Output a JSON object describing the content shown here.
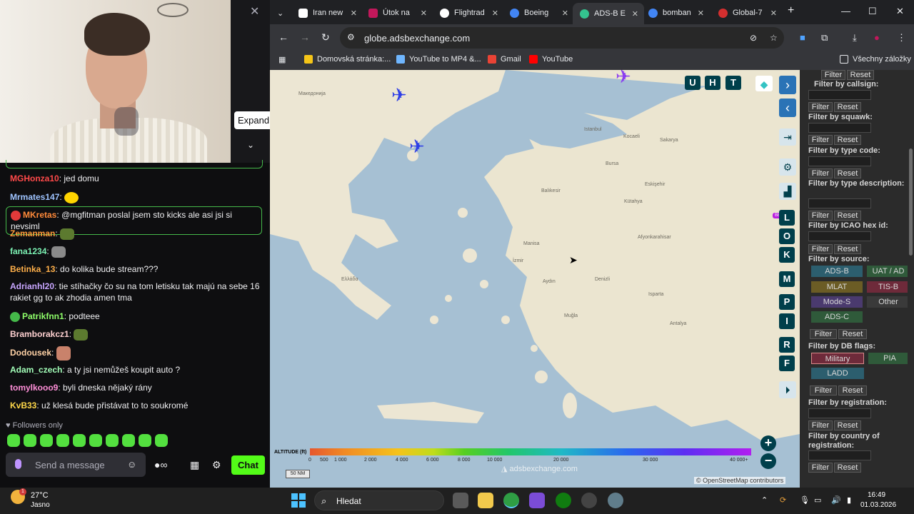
{
  "chat": {
    "expand_tooltip": "Expand",
    "messages": [
      {
        "user": "MGHonza10",
        "color": "#ff4a4a",
        "text": ": jed domu"
      },
      {
        "user": "Mrmates147",
        "color": "#9fc4ff",
        "text": ":"
      },
      {
        "user": "MKretas",
        "color": "#ff8a3a",
        "text": ": @mgfitman poslal jsem sto kicks ale asi jsi si nevsiml"
      },
      {
        "user": "Zemanman",
        "color": "#ff9b3a",
        "text": ":"
      },
      {
        "user": "fana1234",
        "color": "#7bf0b2",
        "text": ":"
      },
      {
        "user": "Betinka_13",
        "color": "#ffb04a",
        "text": ": do kolika bude stream???"
      },
      {
        "user": "Adrianhl20",
        "color": "#c8a6ff",
        "text": ": tie stíhačky čo su na tom letisku tak majú na sebe 16 rakiet gg to ak zhodia amen tma"
      },
      {
        "user": "Patrikfnn1",
        "color": "#8fff6a",
        "text": ": podteee"
      },
      {
        "user": "Bramborakcz1",
        "color": "#ffd1d1",
        "text": ":"
      },
      {
        "user": "Dodousek",
        "color": "#ffd2a6",
        "text": ":"
      },
      {
        "user": "Adam_czech",
        "color": "#a3ffb9",
        "text": ": a ty jsi nemůžeš koupit auto ?"
      },
      {
        "user": "tomylkooo9",
        "color": "#ff8fd8",
        "text": ": byli dneska nějaký rány"
      },
      {
        "user": "KvB33",
        "color": "#ffd84a",
        "text": ": už klesá bude přistávat to to soukromé"
      }
    ],
    "followers_only": "Followers only",
    "input_placeholder": "Send a message",
    "chat_button": "Chat",
    "accent_color": "#53fc18"
  },
  "browser": {
    "tabs": [
      {
        "label": "Iran new",
        "favicon": "news-icon"
      },
      {
        "label": "Útok na",
        "favicon": "tab-icon"
      },
      {
        "label": "Flightrad",
        "favicon": "flightradar-icon"
      },
      {
        "label": "Boeing",
        "favicon": "google-icon"
      },
      {
        "label": "ADS-B E",
        "favicon": "adsb-icon"
      },
      {
        "label": "bomban",
        "favicon": "google-icon"
      },
      {
        "label": "Global-7",
        "favicon": "tab-icon"
      }
    ],
    "active_tab": 4,
    "url": "globe.adsbexchange.com",
    "bookmarks": [
      "Domovská stránka:...",
      "YouTube to MP4 &...",
      "Gmail",
      "YouTube"
    ],
    "all_bookmarks": "Všechny záložky"
  },
  "map": {
    "top_buttons": [
      "U",
      "H",
      "T"
    ],
    "side_buttons": [
      "L",
      "O",
      "K",
      "M",
      "P",
      "I",
      "R",
      "F"
    ],
    "beta_label": "BETA",
    "labels": [
      "Македонија",
      "Ελλάδα",
      "Istanbul",
      "Bursa",
      "Balıkesir",
      "Eskişehir",
      "Kütahya",
      "Afyonkarahisar",
      "Manisa",
      "İzmir",
      "Aydın",
      "Denizli",
      "Muğla",
      "Isparta",
      "Antalya",
      "Kocaeli",
      "Sakarya"
    ],
    "altitude": {
      "label": "ALTITUDE (ft)",
      "ticks": [
        "0",
        "500",
        "1 000",
        "2 000",
        "4 000",
        "6 000",
        "8 000",
        "10 000",
        "20 000",
        "30 000",
        "40 000+"
      ]
    },
    "scale": "50 NM",
    "watermark": "adsbexchange.com",
    "attribution": "© OpenStreetMap contributors"
  },
  "sidebar": {
    "filter_label": "Filter",
    "reset_label": "Reset",
    "filters": [
      "Filter by callsign:",
      "Filter by squawk:",
      "Filter by type code:",
      "Filter by type description:",
      "Filter by ICAO hex id:",
      "Filter by source:",
      "Filter by DB flags:",
      "Filter by registration:",
      "Filter by country of registration:"
    ],
    "sources": [
      "ADS-B",
      "UAT / AD",
      "MLAT",
      "TIS-B",
      "Mode-S",
      "Other",
      "ADS-C"
    ],
    "db_flags": [
      "Military",
      "PIA",
      "LADD"
    ]
  },
  "taskbar": {
    "temperature": "27°C",
    "condition": "Jasno",
    "weather_badge": "1",
    "search_placeholder": "Hledat",
    "time": "16:49",
    "date": "01.03.2026"
  }
}
